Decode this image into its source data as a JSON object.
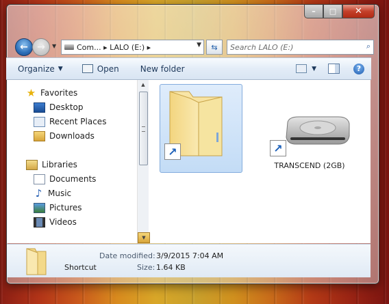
{
  "window": {
    "controls": {
      "minimize": "–",
      "maximize": "□",
      "close": "✕"
    }
  },
  "navigation": {
    "back_icon": "←",
    "forward_icon": "→",
    "address_path": "Com... ▸ LALO (E:) ▸",
    "search_placeholder": "Search LALO (E:)"
  },
  "toolbar": {
    "organize_label": "Organize",
    "open_label": "Open",
    "new_folder_label": "New folder"
  },
  "sidebar": {
    "favorites": {
      "label": "Favorites",
      "items": [
        {
          "label": "Desktop",
          "icon": "desktop-icon"
        },
        {
          "label": "Recent Places",
          "icon": "recent-places-icon"
        },
        {
          "label": "Downloads",
          "icon": "downloads-icon"
        }
      ]
    },
    "libraries": {
      "label": "Libraries",
      "items": [
        {
          "label": "Documents",
          "icon": "documents-icon"
        },
        {
          "label": "Music",
          "icon": "music-icon"
        },
        {
          "label": "Pictures",
          "icon": "pictures-icon"
        },
        {
          "label": "Videos",
          "icon": "videos-icon"
        }
      ]
    }
  },
  "files": [
    {
      "label": "",
      "type": "folder-shortcut",
      "selected": true
    },
    {
      "label": "TRANSCEND (2GB)",
      "type": "drive-shortcut",
      "selected": false
    }
  ],
  "details": {
    "type": "Shortcut",
    "date_modified_label": "Date modified:",
    "date_modified": "3/9/2015 7:04 AM",
    "size_label": "Size:",
    "size": "1.64 KB"
  }
}
